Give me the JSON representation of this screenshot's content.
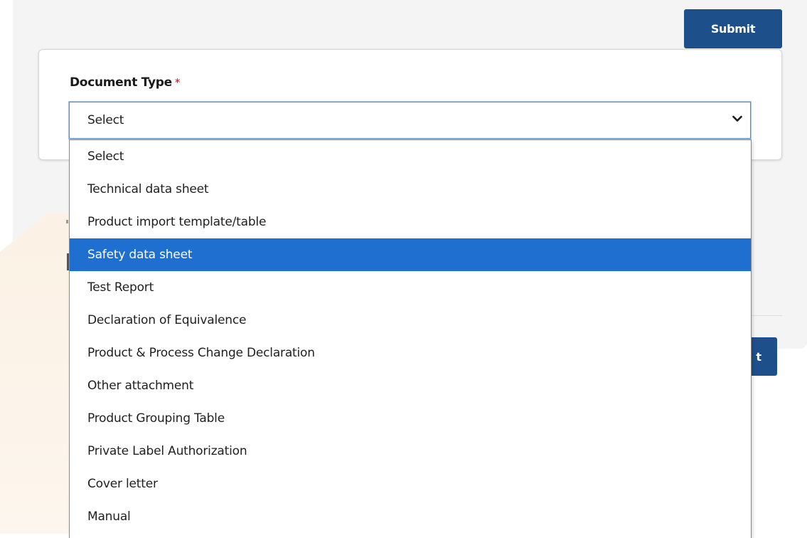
{
  "submit_button": {
    "label": "Submit"
  },
  "form": {
    "document_type": {
      "label": "Document Type",
      "required_marker": "*",
      "selected_value": "Select",
      "highlighted_option": "Safety data sheet",
      "options": [
        "Select",
        "Technical data sheet",
        "Product import template/table",
        "Safety data sheet",
        "Test Report",
        "Declaration of Equivalence",
        "Product & Process Change Declaration",
        "Other attachment",
        "Product Grouping Table",
        "Private Label Authorization",
        "Cover letter",
        "Manual"
      ]
    }
  },
  "background": {
    "partial_button_label": "t"
  },
  "colors": {
    "primary_button": "#1d4f8a",
    "option_highlight": "#1e6fd0",
    "required": "#d0021b",
    "focus_border": "#5f8ec4"
  },
  "icons": {
    "select_arrow": "chevron-down-icon"
  }
}
